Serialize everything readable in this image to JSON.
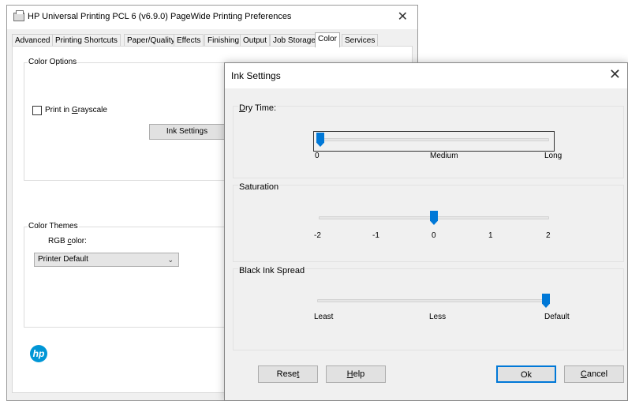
{
  "main_window": {
    "title": "HP Universal Printing PCL 6 (v6.9.0) PageWide Printing Preferences",
    "close": "✕",
    "tabs": [
      {
        "label": "Advanced"
      },
      {
        "label": "Printing Shortcuts"
      },
      {
        "label": "Paper/Quality"
      },
      {
        "label": "Effects"
      },
      {
        "label": "Finishing"
      },
      {
        "label": "Output"
      },
      {
        "label": "Job Storage"
      },
      {
        "label": "Color"
      },
      {
        "label": "Services"
      }
    ],
    "active_tab": "Color",
    "color_options": {
      "legend": "Color Options",
      "grayscale_label": "Print in Grayscale",
      "grayscale_checked": false,
      "ink_settings_button": "Ink Settings"
    },
    "color_themes": {
      "legend": "Color Themes",
      "rgb_label": "RGB color:",
      "rgb_selected": "Printer Default"
    },
    "logo": "hp"
  },
  "ink_dialog": {
    "title": "Ink Settings",
    "close": "✕",
    "dry_time": {
      "label": "Dry Time:",
      "ticks": [
        "0",
        "Medium",
        "Long"
      ],
      "value_fraction": 0.0
    },
    "saturation": {
      "label": "Saturation",
      "ticks": [
        "-2",
        "-1",
        "0",
        "1",
        "2"
      ],
      "value": 0
    },
    "black_ink_spread": {
      "label": "Black Ink Spread",
      "ticks": [
        "Least",
        "Less",
        "Default"
      ],
      "value_fraction": 1.0
    },
    "buttons": {
      "reset": "Reset",
      "help": "Help",
      "ok": "Ok",
      "cancel": "Cancel"
    }
  },
  "colors": {
    "accent": "#0078d7",
    "hp_blue": "#0096d6",
    "window_bg": "#f0f0f0"
  }
}
